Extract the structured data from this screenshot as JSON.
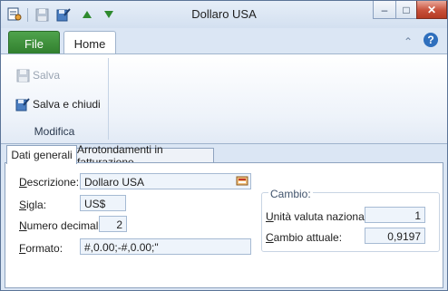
{
  "window": {
    "title": "Dollaro USA"
  },
  "quick_access": {
    "icons": [
      "app-icon",
      "save-icon",
      "save-close-icon",
      "arrow-up-icon",
      "arrow-down-icon"
    ]
  },
  "window_controls": {
    "minimize": "–",
    "maximize": "□",
    "close": "✕"
  },
  "ribbon_tabs": {
    "file": "File",
    "home": "Home"
  },
  "ribbon": {
    "save_label": "Salva",
    "save_close_label": "Salva e chiudi",
    "group_label": "Modifica"
  },
  "content_tabs": {
    "general": "Dati generali",
    "rounding": "Arrotondamenti in fatturazione"
  },
  "form": {
    "descrizione_label": "Descrizione:",
    "descrizione_value": "Dollaro USA",
    "sigla_label": "Sigla:",
    "sigla_value": "US$",
    "decimali_label": "Numero decimali:",
    "decimali_value": "2",
    "formato_label": "Formato:",
    "formato_value": "#,0.00;-#,0.00;\""
  },
  "cambio": {
    "title": "Cambio:",
    "unita_label": "Unità valuta nazionale:",
    "unita_value": "1",
    "attuale_label": "Cambio attuale:",
    "attuale_value": "0,9197"
  },
  "colors": {
    "accent": "#2f7d2c",
    "close": "#c8503a",
    "field_bg": "#eef4fb"
  }
}
